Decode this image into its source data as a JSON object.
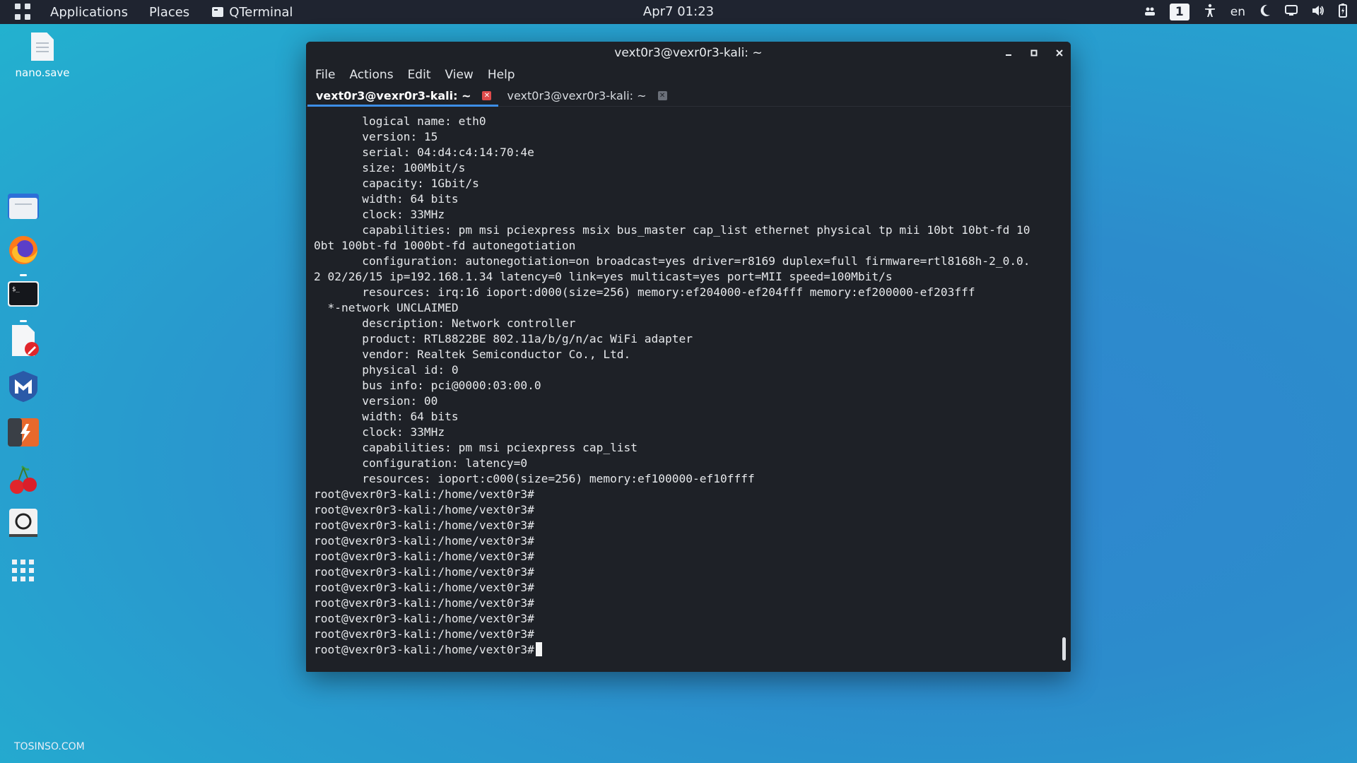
{
  "topbar": {
    "applications": "Applications",
    "places": "Places",
    "task_title": "QTerminal",
    "clock": "Apr7 01:23",
    "workspace": "1",
    "language": "en"
  },
  "desktop": {
    "file_label": "nano.save",
    "watermark": "TOSINSO.COM"
  },
  "window": {
    "title": "vext0r3@vexr0r3-kali: ~",
    "menu": [
      "File",
      "Actions",
      "Edit",
      "View",
      "Help"
    ],
    "tabs": [
      {
        "label": "vext0r3@vexr0r3-kali: ~",
        "active": true
      },
      {
        "label": "vext0r3@vexr0r3-kali: ~",
        "active": false
      }
    ]
  },
  "terminal": {
    "lines": [
      "       logical name: eth0",
      "       version: 15",
      "       serial: 04:d4:c4:14:70:4e",
      "       size: 100Mbit/s",
      "       capacity: 1Gbit/s",
      "       width: 64 bits",
      "       clock: 33MHz",
      "       capabilities: pm msi pciexpress msix bus_master cap_list ethernet physical tp mii 10bt 10bt-fd 10",
      "0bt 100bt-fd 1000bt-fd autonegotiation",
      "       configuration: autonegotiation=on broadcast=yes driver=r8169 duplex=full firmware=rtl8168h-2_0.0.",
      "2 02/26/15 ip=192.168.1.34 latency=0 link=yes multicast=yes port=MII speed=100Mbit/s",
      "       resources: irq:16 ioport:d000(size=256) memory:ef204000-ef204fff memory:ef200000-ef203fff",
      "  *-network UNCLAIMED",
      "       description: Network controller",
      "       product: RTL8822BE 802.11a/b/g/n/ac WiFi adapter",
      "       vendor: Realtek Semiconductor Co., Ltd.",
      "       physical id: 0",
      "       bus info: pci@0000:03:00.0",
      "       version: 00",
      "       width: 64 bits",
      "       clock: 33MHz",
      "       capabilities: pm msi pciexpress cap_list",
      "       configuration: latency=0",
      "       resources: ioport:c000(size=256) memory:ef100000-ef10ffff",
      "root@vexr0r3-kali:/home/vext0r3#",
      "root@vexr0r3-kali:/home/vext0r3#",
      "root@vexr0r3-kali:/home/vext0r3#",
      "root@vexr0r3-kali:/home/vext0r3#",
      "root@vexr0r3-kali:/home/vext0r3#",
      "root@vexr0r3-kali:/home/vext0r3#",
      "root@vexr0r3-kali:/home/vext0r3#",
      "root@vexr0r3-kali:/home/vext0r3#",
      "root@vexr0r3-kali:/home/vext0r3#",
      "root@vexr0r3-kali:/home/vext0r3#"
    ],
    "prompt": "root@vexr0r3-kali:/home/vext0r3#"
  },
  "dock": {
    "icons": [
      "files-icon",
      "firefox-icon",
      "terminal-icon",
      "text-editor-icon",
      "metasploit-icon",
      "burpsuite-icon",
      "cherrytree-icon",
      "screenshot-icon",
      "show-apps-icon"
    ]
  },
  "colors": {
    "panel": "#1f2430",
    "terminal_bg": "#1e2127",
    "tab_accent": "#3d8ee6",
    "close_red": "#e04b4b"
  }
}
